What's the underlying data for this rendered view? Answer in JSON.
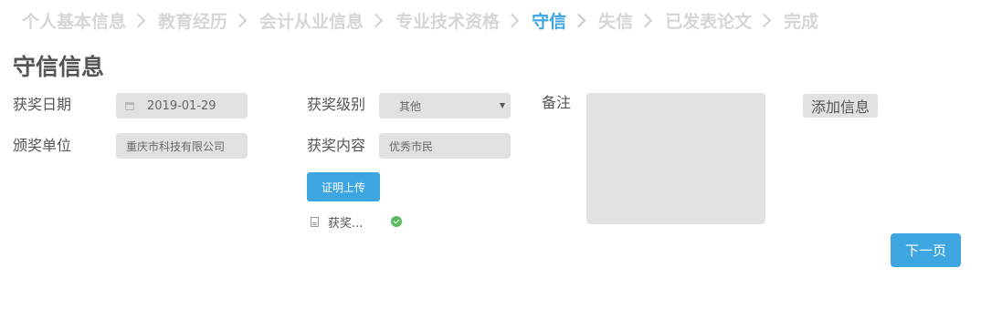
{
  "steps": [
    {
      "label": "个人基本信息",
      "active": false
    },
    {
      "label": "教育经历",
      "active": false
    },
    {
      "label": "会计从业信息",
      "active": false
    },
    {
      "label": "专业技术资格",
      "active": false
    },
    {
      "label": "守信",
      "active": true
    },
    {
      "label": "失信",
      "active": false
    },
    {
      "label": "已发表论文",
      "active": false
    },
    {
      "label": "完成",
      "active": false
    }
  ],
  "page_title": "守信信息",
  "form": {
    "award_date_label": "获奖日期",
    "award_date_value": "2019-01-29",
    "award_level_label": "获奖级别",
    "award_level_value": "其他",
    "issuer_label": "颁奖单位",
    "issuer_value": "重庆市科技有限公司",
    "award_content_label": "获奖内容",
    "award_content_value": "优秀市民",
    "remark_label": "备注"
  },
  "upload_button": "证明上传",
  "uploaded_file": {
    "name": "获奖...",
    "status": "success"
  },
  "add_info_button": "添加信息",
  "next_button": "下一页",
  "colors": {
    "accent": "#3da5e0",
    "field_bg": "#e1e1e1",
    "success": "#5cb85c",
    "inactive_step": "#d6d6d6"
  }
}
